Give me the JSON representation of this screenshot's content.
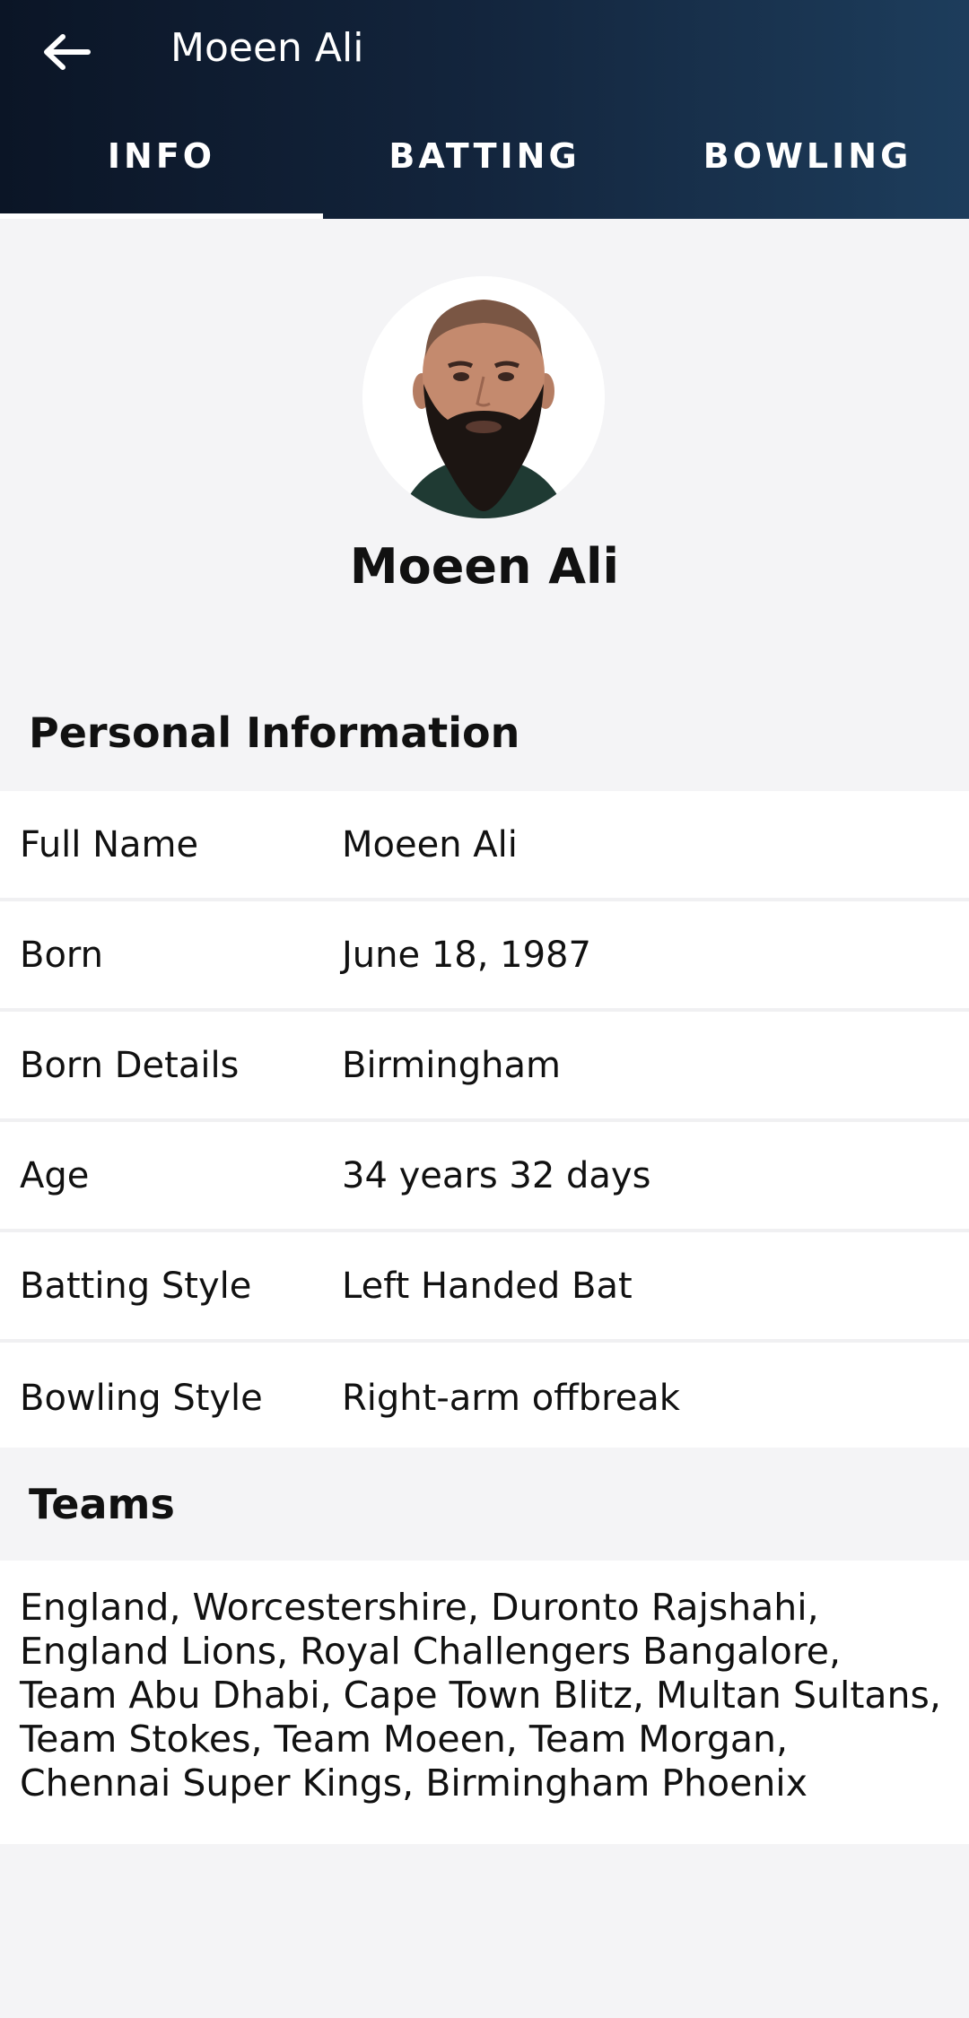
{
  "header": {
    "title": "Moeen Ali",
    "tabs": [
      {
        "label": "INFO",
        "active": true
      },
      {
        "label": "BATTING",
        "active": false
      },
      {
        "label": "BOWLING",
        "active": false
      }
    ]
  },
  "profile": {
    "name": "Moeen Ali"
  },
  "personal": {
    "heading": "Personal Information",
    "rows": [
      {
        "label": "Full Name",
        "value": "Moeen Ali"
      },
      {
        "label": "Born",
        "value": "June 18, 1987"
      },
      {
        "label": "Born Details",
        "value": "Birmingham"
      },
      {
        "label": "Age",
        "value": "34 years 32 days"
      },
      {
        "label": "Batting Style",
        "value": "Left Handed Bat"
      },
      {
        "label": "Bowling Style",
        "value": "Right-arm offbreak"
      }
    ]
  },
  "teams": {
    "heading": "Teams",
    "text": "England, Worcestershire, Duronto Rajshahi, England Lions, Royal Challengers Bangalore, Team Abu Dhabi, Cape Town Blitz, Multan Sultans, Team Stokes, Team Moeen, Team Morgan, Chennai Super Kings, Birmingham Phoenix"
  }
}
